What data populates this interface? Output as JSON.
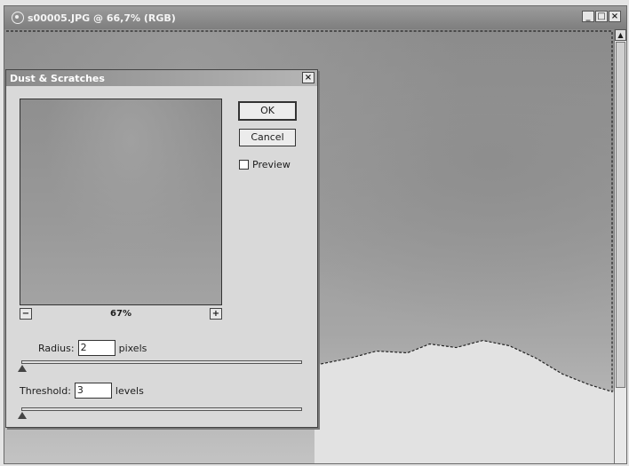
{
  "document": {
    "title": "s00005.JPG @ 66,7% (RGB)",
    "icon": "photoshop-document-icon",
    "controls": {
      "minimize": "_",
      "maximize": "□",
      "close": "×"
    }
  },
  "dialog": {
    "title": "Dust & Scratches",
    "close_label": "×",
    "ok_label": "OK",
    "cancel_label": "Cancel",
    "preview_label": "Preview",
    "preview_checked": false,
    "zoom": {
      "value": "67%",
      "minus": "−",
      "plus": "+"
    },
    "radius": {
      "label": "Radius:",
      "value": "2",
      "unit": "pixels"
    },
    "threshold": {
      "label": "Threshold:",
      "value": "3",
      "unit": "levels"
    }
  }
}
